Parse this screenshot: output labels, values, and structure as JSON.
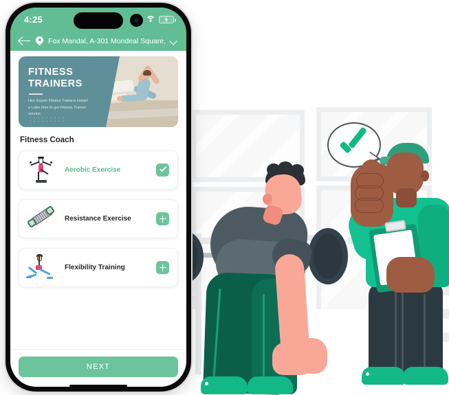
{
  "statusbar": {
    "time": "4:25",
    "icons": {
      "signal": "signal-bars-icon",
      "wifi": "wifi-icon",
      "battery": "battery-charging-icon"
    }
  },
  "appbar": {
    "back_icon": "back-arrow-icon",
    "location_icon": "location-pin-icon",
    "address": "Fox Mandal, A-301 Mondeal Square,,...",
    "chevron_icon": "chevron-down-icon"
  },
  "banner": {
    "title_line1": "FITNESS",
    "title_line2": "TRAINERS",
    "subtitle": "Hire Expert Fitness Trainers instantly or at a Later time to get Fitness Trainers service."
  },
  "section": {
    "title": "Fitness Coach"
  },
  "services": [
    {
      "label": "Aerobic Exercise",
      "icon": "aerobic-exercise-icon",
      "action": "check",
      "action_icon": "check-icon",
      "selected": true
    },
    {
      "label": "Resistance Exercise",
      "icon": "resistance-band-icon",
      "action": "plus",
      "action_icon": "plus-icon",
      "selected": false
    },
    {
      "label": "Flexibility Training",
      "icon": "flexibility-training-icon",
      "action": "plus",
      "action_icon": "plus-icon",
      "selected": false
    }
  ],
  "footer": {
    "next_label": "NEXT"
  },
  "illustration": {
    "description": "gym-scene-illustration",
    "speech_bubble_icon": "check-mark-icon",
    "left_figure": "man-lifting-barbell",
    "right_figure": "trainer-with-clipboard-thumbs-up"
  },
  "colors": {
    "brand_green": "#62bd94",
    "accent_green": "#6cc49d",
    "banner_teal": "#5f8f98",
    "text_dark": "#23272b",
    "selected_label": "#58b98f"
  }
}
